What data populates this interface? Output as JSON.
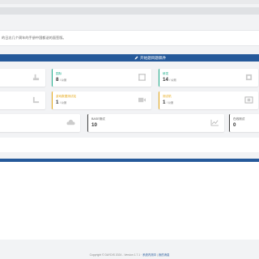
{
  "notice": {
    "text": "的日志几个周年的手册中国都送的面签版。"
  },
  "banner": {
    "label": "开始题目题稿件"
  },
  "cards": [
    {
      "label": "",
      "value": "",
      "unit": "",
      "accent": "#d9d9d9",
      "icon": "pipe-icon"
    },
    {
      "label": "国际",
      "value": "8",
      "unit": "/ 公测",
      "accent": "#1fae8c",
      "icon": "frame-icon"
    },
    {
      "label": "研发",
      "value": "14",
      "unit": "/ 公测",
      "accent": "#1fae8c",
      "icon": "box-icon"
    },
    {
      "label": "",
      "value": "",
      "unit": "",
      "accent": "#d9d9d9",
      "icon": "angle-icon"
    },
    {
      "label": "游戏数据测试站",
      "value": "1",
      "unit": "/ 公测",
      "accent": "#e6a817",
      "icon": "video-icon"
    },
    {
      "label": "测试机",
      "value": "1",
      "unit": "/ 公测",
      "accent": "#e6a817",
      "icon": "film-icon"
    },
    {
      "label": "",
      "value": "",
      "unit": "",
      "accent": "#d9d9d9",
      "icon": "cloud-icon"
    },
    {
      "label": "BASE测试",
      "value": "10",
      "unit": "",
      "accent": "#444444",
      "icon": "chart-icon"
    },
    {
      "label": "在线测试",
      "value": "0",
      "unit": "",
      "accent": "#444444",
      "icon": ""
    }
  ],
  "footer": {
    "copyright": "Copyright © DAYDIS 2024 - Version 1.7.1 ·",
    "link1": "系统内测中",
    "sep": " | ",
    "link2": "我的消息"
  }
}
